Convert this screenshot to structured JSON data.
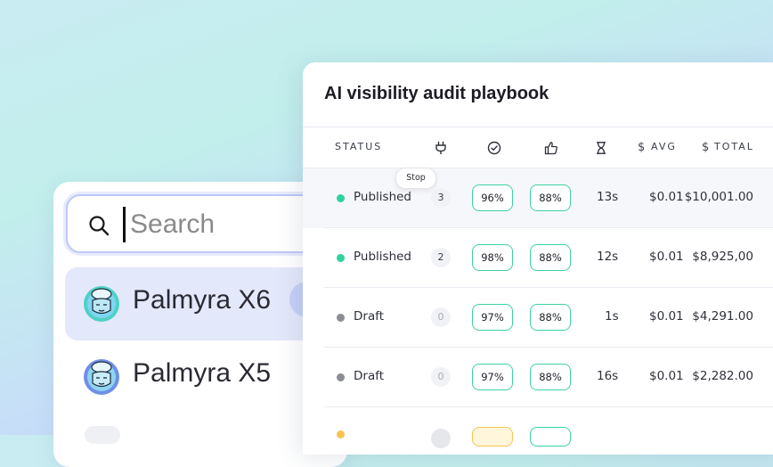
{
  "search": {
    "placeholder": "Search"
  },
  "models": [
    {
      "name": "Palmyra X6",
      "selected": true
    },
    {
      "name": "Palmyra X5",
      "selected": false
    }
  ],
  "card": {
    "title": "AI visibility audit playbook"
  },
  "columns": {
    "status": "STATUS",
    "avg": "AVG",
    "total": "TOTAL"
  },
  "column_icons": [
    "plug-icon",
    "check-circle-icon",
    "thumbs-up-icon",
    "hourglass-icon"
  ],
  "tooltip": "Stop",
  "rows": [
    {
      "status": "Published",
      "status_color": "#2fd29b",
      "count": "3",
      "pct1": "96%",
      "pct2": "88%",
      "time": "13s",
      "avg": "$0.01",
      "total": "$10,001.00"
    },
    {
      "status": "Published",
      "status_color": "#2fd29b",
      "count": "2",
      "pct1": "98%",
      "pct2": "88%",
      "time": "12s",
      "avg": "$0.01",
      "total": "$8,925,00"
    },
    {
      "status": "Draft",
      "status_color": "#8c8e96",
      "count": "0",
      "pct1": "97%",
      "pct2": "88%",
      "time": "1s",
      "avg": "$0.01",
      "total": "$4,291.00"
    },
    {
      "status": "Draft",
      "status_color": "#8c8e96",
      "count": "0",
      "pct1": "97%",
      "pct2": "88%",
      "time": "16s",
      "avg": "$0.01",
      "total": "$2,282.00"
    }
  ],
  "colors": {
    "accent_green": "#3ed0a6",
    "accent_amber": "#f7c552",
    "selection": "#e3e8fb"
  }
}
